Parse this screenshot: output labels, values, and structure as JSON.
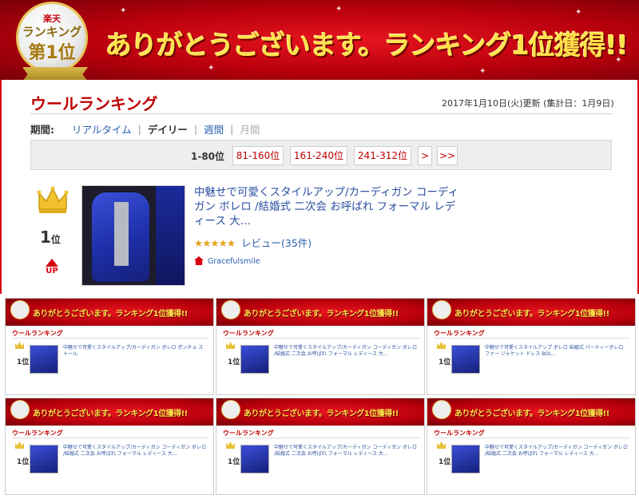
{
  "banner": {
    "text": "ありがとうございます。ランキング1位獲得!!",
    "badge_top": "楽天",
    "badge_mid": "ランキング",
    "badge_bottom": "第1位"
  },
  "header": {
    "title": "ウールランキング",
    "updated": "2017年1月10日(火)更新 (集計日：1月9日)"
  },
  "period": {
    "label": "期間:",
    "items": [
      "リアルタイム",
      "デイリー",
      "週間",
      "月間"
    ],
    "separators": [
      "|",
      "|",
      "|"
    ]
  },
  "pager": {
    "current": "1-80位",
    "pages": [
      "81-160位",
      "161-240位",
      "241-312位",
      ">",
      ">>"
    ]
  },
  "product": {
    "rank": "1",
    "rank_suffix": "位",
    "trend": "UP",
    "title": "中魅せで可愛くスタイルアップ/カーディガン コーディガン ボレロ /結婚式 二次会 お呼ばれ フォーマル レディース 大…",
    "stars": "★★★★★",
    "reviews": "レビュー(35件)",
    "shop": "Gracefulsmile"
  },
  "tiles": [
    {
      "title": "ありがとうございます。ランキング1位獲得!!",
      "heading": "ウールランキング",
      "rank": "1位",
      "text": "中魅せで可愛くスタイルアップ/カーディガン ボレロ ポンチョ ストール"
    },
    {
      "title": "ありがとうございます。ランキング1位獲得!!",
      "heading": "ウールランキング",
      "rank": "1位",
      "text": "中魅せで可愛くスタイルアップ/カーディガン コーディガン ボレロ /結婚式 二次会 お呼ばれ フォーマル レディース 大…"
    },
    {
      "title": "ありがとうございます。ランキング1位獲得!!",
      "heading": "ウールランキング",
      "rank": "1位",
      "text": "中魅せで可愛くスタイルアップ ボレロ 結婚式 パーティーボレロ ファー ジャケット ドレス BOL…"
    },
    {
      "title": "ありがとうございます。ランキング1位獲得!!",
      "heading": "ウールランキング",
      "rank": "1位",
      "text": "中魅せで可愛くスタイルアップ/カーディガン コーディガン ボレロ /結婚式 二次会 お呼ばれ フォーマル レディース 大…"
    },
    {
      "title": "ありがとうございます。ランキング1位獲得!!",
      "heading": "ウールランキング",
      "rank": "1位",
      "text": "中魅せで可愛くスタイルアップ/カーディガン コーディガン ボレロ /結婚式 二次会 お呼ばれ フォーマル レディース 大…"
    },
    {
      "title": "ありがとうございます。ランキング1位獲得!!",
      "heading": "ウールランキング",
      "rank": "1位",
      "text": "中魅せで可愛くスタイルアップ/カーディガン コーディガン ボレロ /結婚式 二次会 お呼ばれ フォーマル レディース 大…"
    }
  ],
  "colors": {
    "accent": "#bf0000",
    "link": "#2b5fb0",
    "gold": "#ffe14a"
  }
}
